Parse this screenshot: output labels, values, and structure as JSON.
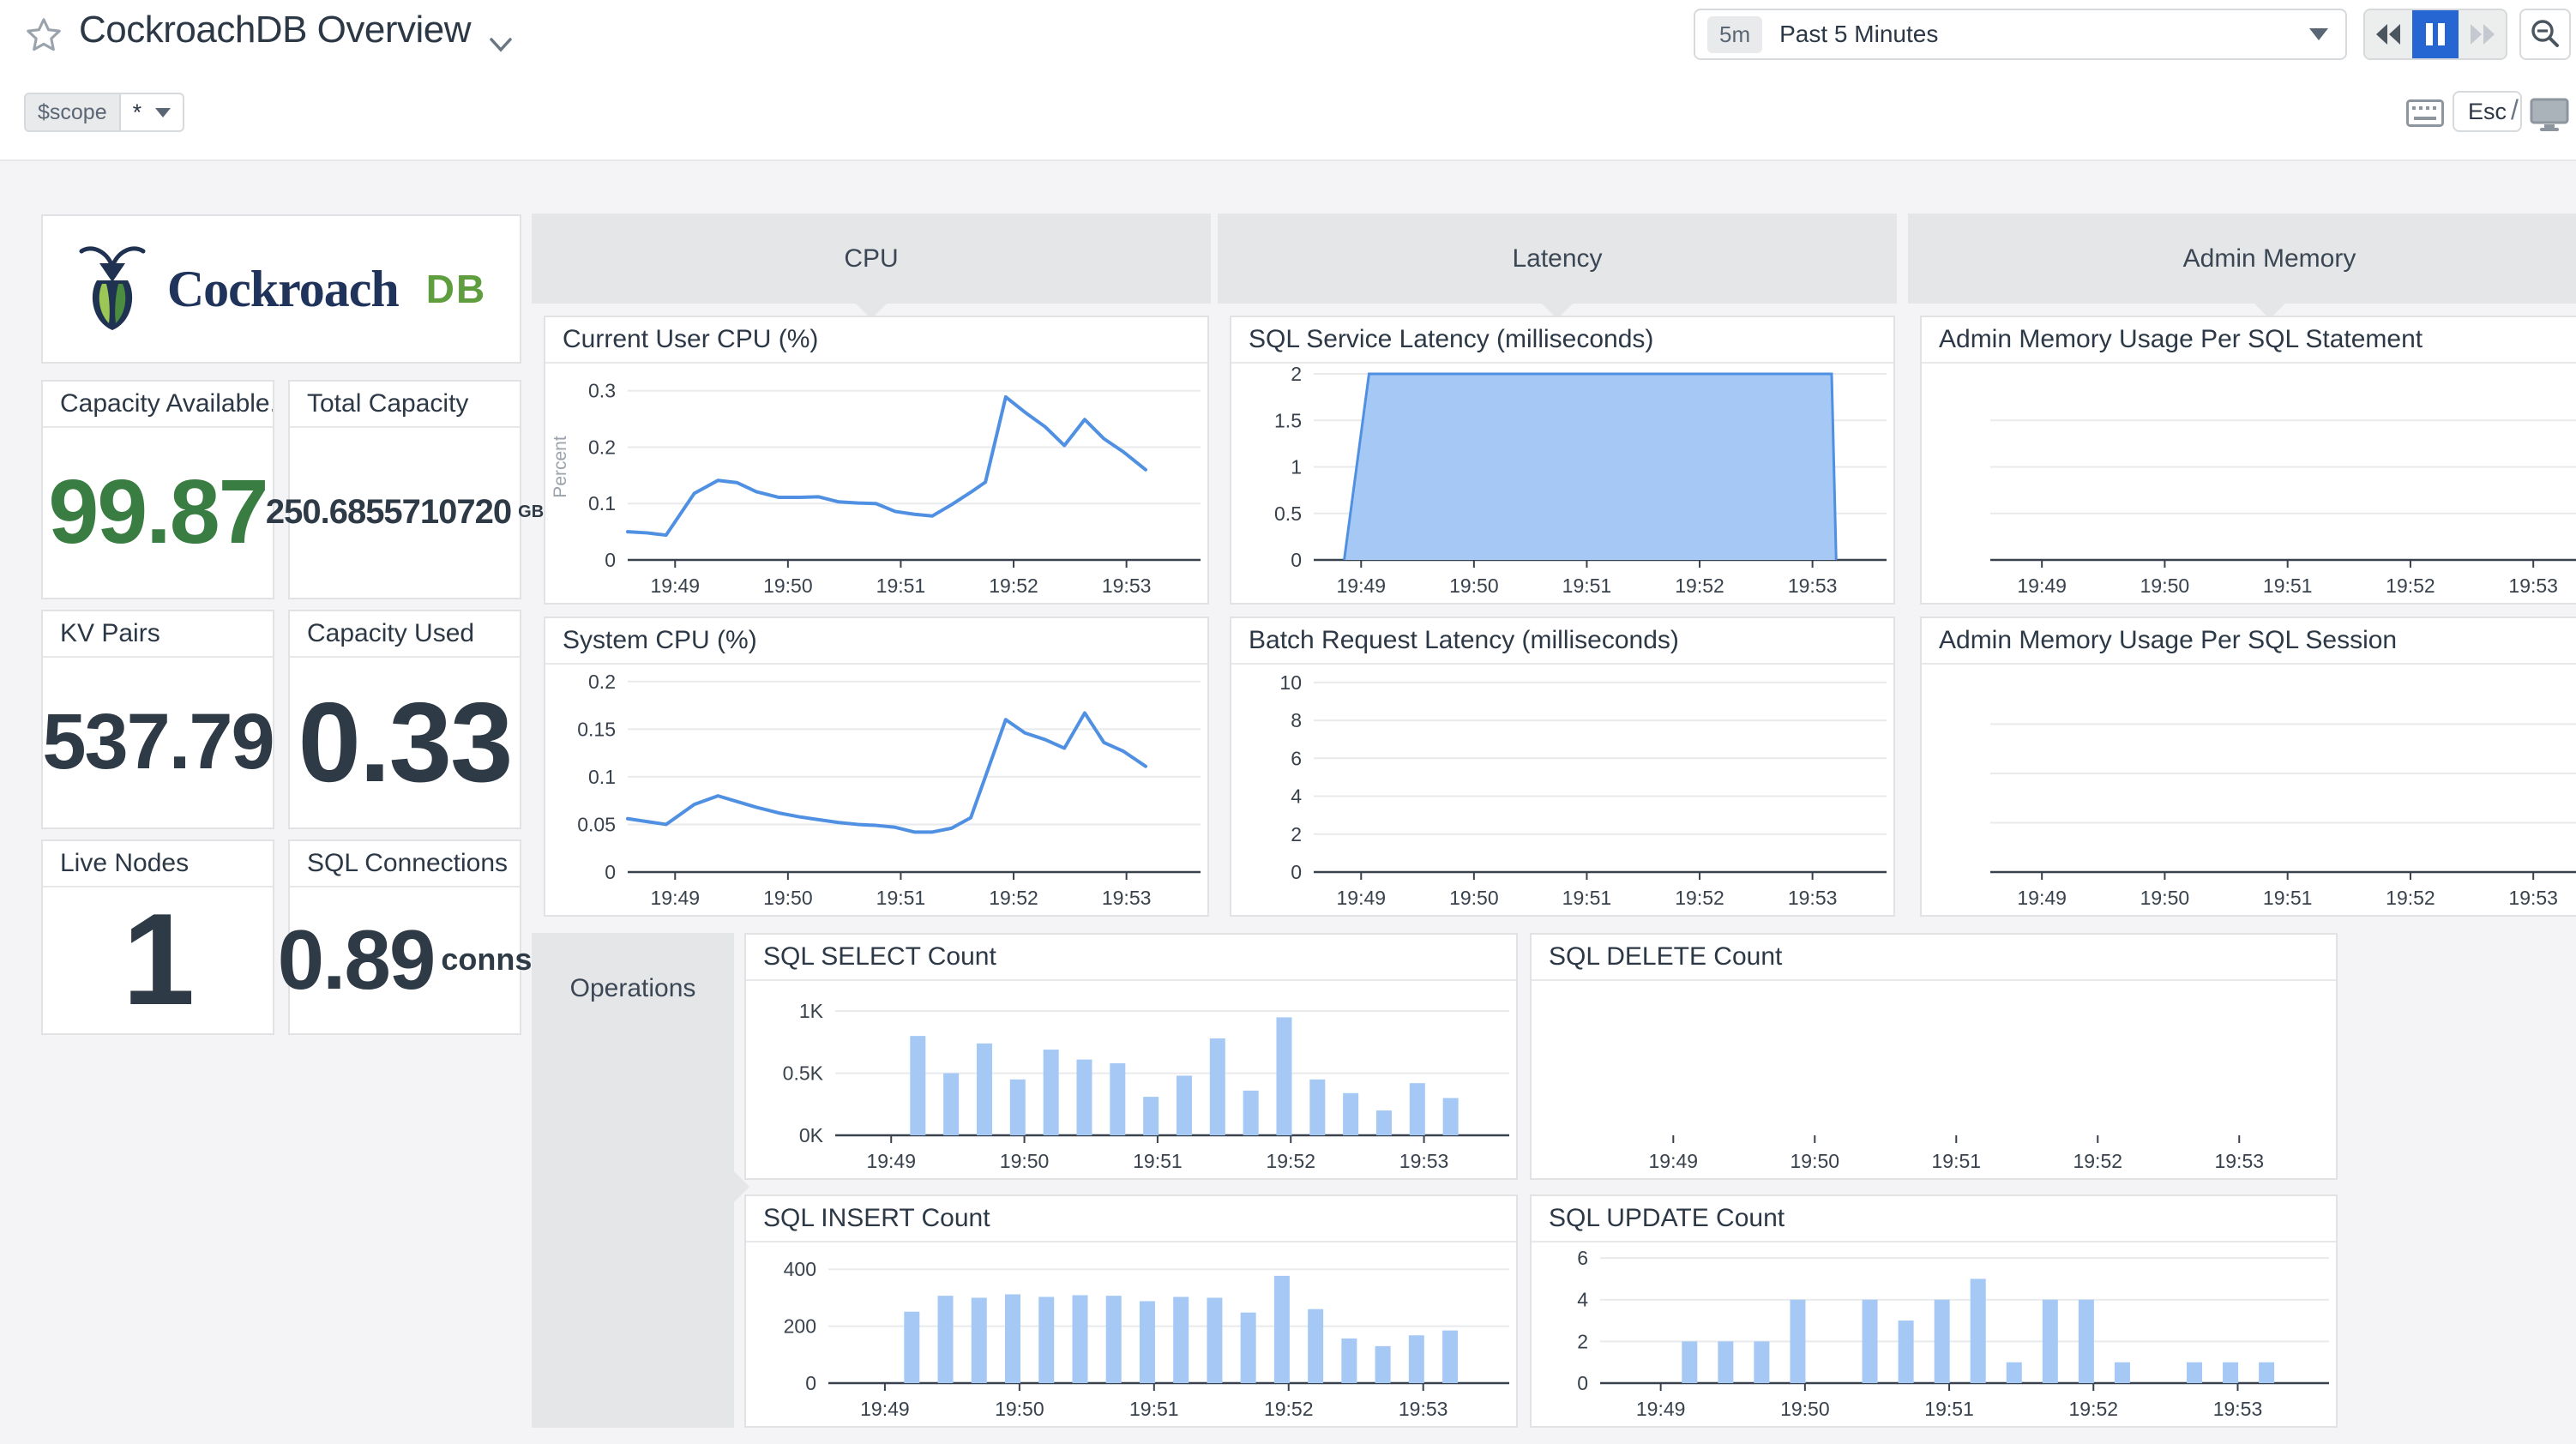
{
  "header": {
    "title": "CockroachDB Overview",
    "time_range_badge": "5m",
    "time_range_label": "Past 5 Minutes",
    "esc_label": "Esc",
    "slash": "/",
    "scope_var": "$scope",
    "scope_value": "*"
  },
  "logo": {
    "word": "Cockroach",
    "suffix": "DB"
  },
  "groups": {
    "cpu": "CPU",
    "latency": "Latency",
    "admin": "Admin Memory",
    "operations": "Operations"
  },
  "stats": [
    {
      "title": "Capacity Available...",
      "value": "99.87",
      "unit": ""
    },
    {
      "title": "Total Capacity",
      "value": "250.6855710720",
      "unit": "GB"
    },
    {
      "title": "KV Pairs",
      "value": "537.79",
      "unit": ""
    },
    {
      "title": "Capacity Used",
      "value": "0.33",
      "unit": ""
    },
    {
      "title": "Live Nodes",
      "value": "1",
      "unit": ""
    },
    {
      "title": "SQL Connections",
      "value": "0.89",
      "unit": "conns"
    }
  ],
  "theme": {
    "line_blue": "#4f90e2",
    "fill_blue": "#a5c9f4",
    "axis_dark": "#39424c",
    "grid_gray": "#e9eaec",
    "muted_gray": "#9aa2ab",
    "pause_blue": "#2566d2",
    "stat_green": "#3a7d42"
  },
  "chart_data": {
    "user_cpu": {
      "type": "line",
      "title": "Current User CPU (%)",
      "ylabel": "Percent",
      "ymax": 0.33,
      "xdomain": [
        48.58,
        53.55
      ],
      "yticks": [
        [
          0,
          "0"
        ],
        [
          0.1,
          "0.1"
        ],
        [
          0.2,
          "0.2"
        ],
        [
          0.3,
          "0.3"
        ]
      ],
      "xticks": [
        [
          49,
          "19:49"
        ],
        [
          50,
          "19:50"
        ],
        [
          51,
          "19:51"
        ],
        [
          52,
          "19:52"
        ],
        [
          53,
          "19:53"
        ]
      ],
      "points": [
        [
          48.58,
          0.05
        ],
        [
          48.75,
          0.048
        ],
        [
          48.92,
          0.044
        ],
        [
          49.17,
          0.118
        ],
        [
          49.38,
          0.141
        ],
        [
          49.55,
          0.137
        ],
        [
          49.72,
          0.121
        ],
        [
          49.92,
          0.111
        ],
        [
          50.1,
          0.111
        ],
        [
          50.27,
          0.112
        ],
        [
          50.45,
          0.103
        ],
        [
          50.62,
          0.101
        ],
        [
          50.78,
          0.1
        ],
        [
          50.95,
          0.086
        ],
        [
          51.12,
          0.081
        ],
        [
          51.28,
          0.078
        ],
        [
          51.45,
          0.098
        ],
        [
          51.62,
          0.12
        ],
        [
          51.75,
          0.138
        ],
        [
          51.93,
          0.289
        ],
        [
          52.1,
          0.262
        ],
        [
          52.28,
          0.236
        ],
        [
          52.45,
          0.203
        ],
        [
          52.63,
          0.249
        ],
        [
          52.8,
          0.215
        ],
        [
          52.97,
          0.192
        ],
        [
          53.17,
          0.16
        ]
      ]
    },
    "system_cpu": {
      "type": "line",
      "title": "System CPU (%)",
      "ymax": 0.207,
      "xdomain": [
        48.58,
        53.55
      ],
      "yticks": [
        [
          0,
          "0"
        ],
        [
          0.05,
          "0.05"
        ],
        [
          0.1,
          "0.1"
        ],
        [
          0.15,
          "0.15"
        ],
        [
          0.2,
          "0.2"
        ]
      ],
      "xticks": [
        [
          49,
          "19:49"
        ],
        [
          50,
          "19:50"
        ],
        [
          51,
          "19:51"
        ],
        [
          52,
          "19:52"
        ],
        [
          53,
          "19:53"
        ]
      ],
      "points": [
        [
          48.58,
          0.056
        ],
        [
          48.75,
          0.053
        ],
        [
          48.92,
          0.05
        ],
        [
          49.17,
          0.071
        ],
        [
          49.38,
          0.08
        ],
        [
          49.55,
          0.074
        ],
        [
          49.72,
          0.068
        ],
        [
          49.92,
          0.062
        ],
        [
          50.1,
          0.058
        ],
        [
          50.27,
          0.055
        ],
        [
          50.45,
          0.052
        ],
        [
          50.62,
          0.05
        ],
        [
          50.78,
          0.049
        ],
        [
          50.95,
          0.047
        ],
        [
          51.12,
          0.042
        ],
        [
          51.28,
          0.042
        ],
        [
          51.45,
          0.046
        ],
        [
          51.62,
          0.057
        ],
        [
          51.93,
          0.16
        ],
        [
          52.1,
          0.146
        ],
        [
          52.28,
          0.139
        ],
        [
          52.45,
          0.13
        ],
        [
          52.63,
          0.167
        ],
        [
          52.8,
          0.136
        ],
        [
          52.97,
          0.127
        ],
        [
          53.17,
          0.111
        ]
      ]
    },
    "sql_service_latency": {
      "type": "area",
      "title": "SQL Service Latency (milliseconds)",
      "ymax": 2,
      "xdomain": [
        48.58,
        53.55
      ],
      "yticks": [
        [
          0,
          "0"
        ],
        [
          0.5,
          "0.5"
        ],
        [
          1,
          "1"
        ],
        [
          1.5,
          "1.5"
        ],
        [
          2,
          "2"
        ]
      ],
      "xticks": [
        [
          49,
          "19:49"
        ],
        [
          50,
          "19:50"
        ],
        [
          51,
          "19:51"
        ],
        [
          52,
          "19:52"
        ],
        [
          53,
          "19:53"
        ]
      ],
      "points": [
        [
          48.85,
          0
        ],
        [
          49.07,
          2
        ],
        [
          53.17,
          2
        ],
        [
          53.21,
          0
        ]
      ]
    },
    "batch_request_latency": {
      "type": "empty",
      "title": "Batch Request Latency (milliseconds)",
      "ymax": 10.4,
      "xdomain": [
        48.58,
        53.55
      ],
      "yticks": [
        [
          0,
          "0"
        ],
        [
          2,
          "2"
        ],
        [
          4,
          "4"
        ],
        [
          6,
          "6"
        ],
        [
          8,
          "8"
        ],
        [
          10,
          "10"
        ]
      ],
      "xticks": [
        [
          49,
          "19:49"
        ],
        [
          50,
          "19:50"
        ],
        [
          51,
          "19:51"
        ],
        [
          52,
          "19:52"
        ],
        [
          53,
          "19:53"
        ]
      ]
    },
    "admin_mem_statement": {
      "type": "empty",
      "title": "Admin Memory Usage Per SQL Statement",
      "ymax": 4,
      "xdomain": [
        48.58,
        53.55
      ],
      "mleft": 80,
      "mright": 34,
      "yticks": [
        [
          1,
          null
        ],
        [
          2,
          null
        ],
        [
          3,
          null
        ]
      ],
      "xticks": [
        [
          49,
          "19:49"
        ],
        [
          50,
          "19:50"
        ],
        [
          51,
          "19:51"
        ],
        [
          52,
          "19:52"
        ],
        [
          53,
          "19:53"
        ]
      ]
    },
    "admin_mem_session": {
      "type": "empty",
      "title": "Admin Memory Usage Per SQL Session",
      "ymax": 4,
      "xdomain": [
        48.58,
        53.55
      ],
      "mleft": 80,
      "mright": 34,
      "yticks": [
        [
          1,
          null
        ],
        [
          2,
          null
        ],
        [
          3,
          null
        ]
      ],
      "xticks": [
        [
          49,
          "19:49"
        ],
        [
          50,
          "19:50"
        ],
        [
          51,
          "19:51"
        ],
        [
          52,
          "19:52"
        ],
        [
          53,
          "19:53"
        ]
      ]
    },
    "sql_select_count": {
      "type": "bar",
      "title": "SQL SELECT Count",
      "ymax": 1160,
      "xdomain": [
        48.58,
        53.55
      ],
      "mleft": 104,
      "barstart": 49.2,
      "barstep": 0.25,
      "yticks": [
        [
          0,
          "0K"
        ],
        [
          500,
          "0.5K"
        ],
        [
          1000,
          "1K"
        ]
      ],
      "xticks": [
        [
          49,
          "19:49"
        ],
        [
          50,
          "19:50"
        ],
        [
          51,
          "19:51"
        ],
        [
          52,
          "19:52"
        ],
        [
          53,
          "19:53"
        ]
      ],
      "values": [
        800,
        500,
        740,
        450,
        690,
        610,
        580,
        310,
        480,
        780,
        360,
        950,
        450,
        340,
        200,
        420,
        300
      ]
    },
    "sql_delete_count": {
      "type": "empty",
      "title": "SQL DELETE Count",
      "ymax": 1,
      "xdomain": [
        48.58,
        53.55
      ],
      "axis": false,
      "yticks": [],
      "xticks": [
        [
          49,
          "19:49"
        ],
        [
          50,
          "19:50"
        ],
        [
          51,
          "19:51"
        ],
        [
          52,
          "19:52"
        ],
        [
          53,
          "19:53"
        ]
      ]
    },
    "sql_insert_count": {
      "type": "bar",
      "title": "SQL INSERT Count",
      "ymax": 458,
      "xdomain": [
        48.58,
        53.55
      ],
      "barstart": 49.2,
      "barstep": 0.25,
      "yticks": [
        [
          0,
          "0"
        ],
        [
          200,
          "200"
        ],
        [
          400,
          "400"
        ]
      ],
      "xticks": [
        [
          49,
          "19:49"
        ],
        [
          50,
          "19:50"
        ],
        [
          51,
          "19:51"
        ],
        [
          52,
          "19:52"
        ],
        [
          53,
          "19:53"
        ]
      ],
      "values": [
        251,
        307,
        300,
        312,
        303,
        309,
        307,
        288,
        303,
        300,
        248,
        377,
        260,
        157,
        130,
        168,
        185
      ]
    },
    "sql_update_count": {
      "type": "bar",
      "title": "SQL UPDATE Count",
      "ymax": 6.25,
      "xdomain": [
        48.58,
        53.55
      ],
      "mleft": 80,
      "barstart": 49.2,
      "barstep": 0.25,
      "yticks": [
        [
          0,
          "0"
        ],
        [
          2,
          "2"
        ],
        [
          4,
          "4"
        ],
        [
          6,
          "6"
        ]
      ],
      "xticks": [
        [
          49,
          "19:49"
        ],
        [
          50,
          "19:50"
        ],
        [
          51,
          "19:51"
        ],
        [
          52,
          "19:52"
        ],
        [
          53,
          "19:53"
        ]
      ],
      "values": [
        2,
        2,
        2,
        4,
        0,
        4,
        3,
        4,
        5,
        1,
        4,
        4,
        1,
        0,
        1,
        1,
        1
      ]
    }
  }
}
